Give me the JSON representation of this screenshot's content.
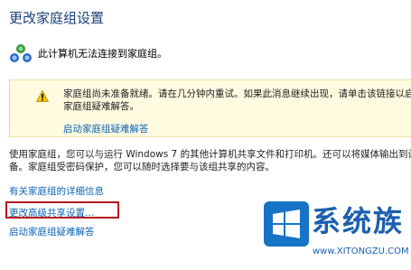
{
  "page": {
    "title": "更改家庭组设置"
  },
  "status": {
    "text": "此计算机无法连接到家庭组。"
  },
  "warning": {
    "text": "家庭组尚未准备就绪。请在几分钟内重试。如果此消息继续出现，请单击该链接以启动家庭组疑难解答。",
    "link_label": "启动家庭组疑难解答"
  },
  "description": {
    "text": "使用家庭组，您可以与运行 Windows 7 的其他计算机共享文件和打印机。还可以将媒体输出到设备。家庭组受密码保护，您可以随时选择要与该组共享的内容。"
  },
  "links": {
    "details": "有关家庭组的详细信息",
    "advanced_sharing": "更改高级共享设置...",
    "troubleshoot": "启动家庭组疑难解答"
  },
  "watermark": {
    "brand": "系统族",
    "url": "www.XITONGZU.COM"
  },
  "colors": {
    "title": "#1a3f7a",
    "link": "#0b63b6",
    "warning_bg": "#fffbe0",
    "highlight": "#b7161d",
    "watermark": "#1c5fae"
  },
  "icons": {
    "status": "homegroup-network-icon",
    "warning": "warning-triangle-icon",
    "watermark_logo": "windows-logo-icon"
  }
}
